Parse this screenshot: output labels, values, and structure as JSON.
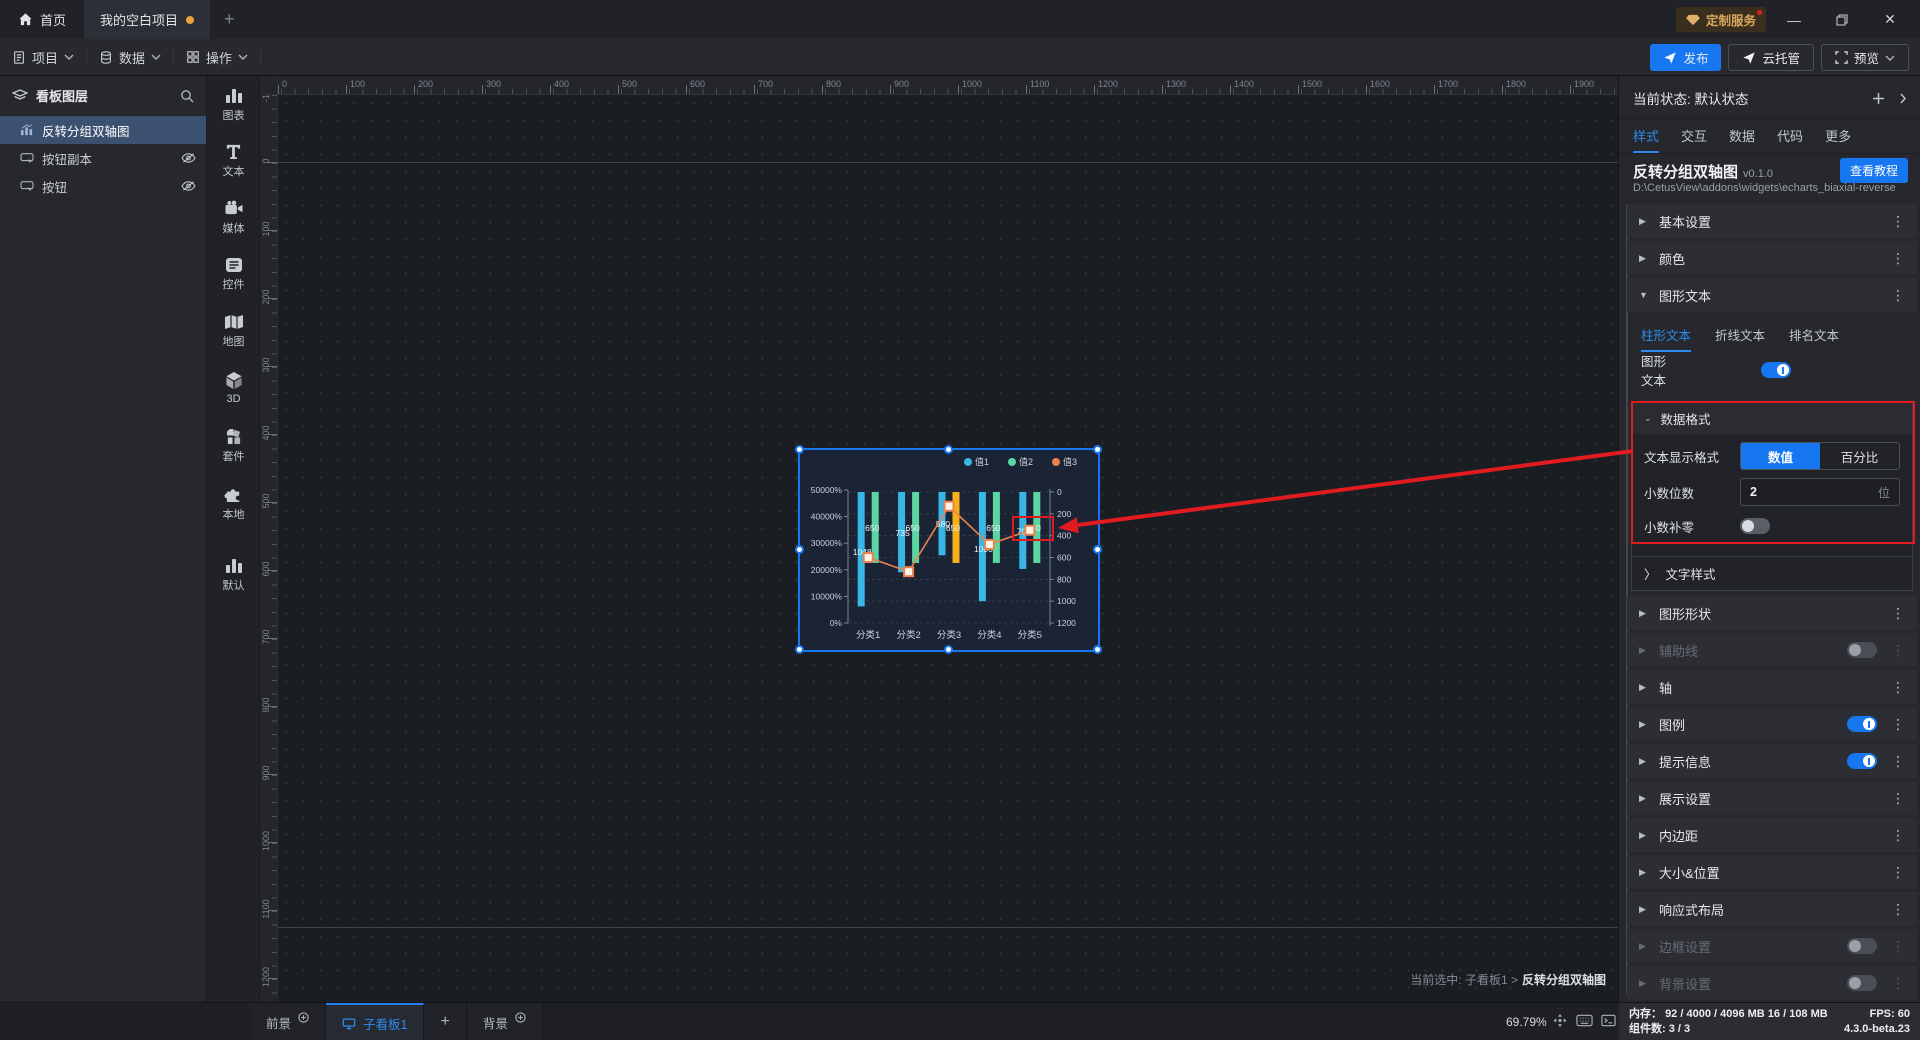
{
  "window": {
    "home_tab": "首页",
    "project_tab": "我的空白项目",
    "service_badge": "定制服务"
  },
  "menubar": {
    "items": [
      {
        "label": "项目",
        "icon": "doc"
      },
      {
        "label": "数据",
        "icon": "db"
      },
      {
        "label": "操作",
        "icon": "grid"
      }
    ],
    "publish": "发布",
    "cloud": "云托管",
    "preview": "预览"
  },
  "layers": {
    "title": "看板图层",
    "items": [
      {
        "label": "反转分组双轴图",
        "icon": "chart",
        "selected": true,
        "eye": false
      },
      {
        "label": "按钮副本",
        "icon": "button",
        "selected": false,
        "eye": true
      },
      {
        "label": "按钮",
        "icon": "button",
        "selected": false,
        "eye": true
      }
    ]
  },
  "dock": {
    "items": [
      {
        "label": "图表",
        "icon": "bars"
      },
      {
        "label": "文本",
        "icon": "text"
      },
      {
        "label": "媒体",
        "icon": "media"
      },
      {
        "label": "控件",
        "icon": "widgetic"
      },
      {
        "label": "地图",
        "icon": "map"
      },
      {
        "label": "3D",
        "icon": "cube"
      },
      {
        "label": "套件",
        "icon": "kit"
      },
      {
        "label": "本地",
        "icon": "puzzle"
      },
      {
        "label": "默认",
        "icon": "bars"
      }
    ]
  },
  "canvas": {
    "h_ruler": [
      0,
      100,
      200,
      300,
      400,
      500,
      600,
      700,
      800,
      900,
      1000,
      1100,
      1200,
      1300,
      1400,
      1500,
      1600,
      1700,
      1800,
      1900
    ],
    "v_ruler": [
      -100,
      0,
      100,
      200,
      300,
      400,
      500,
      600,
      700,
      800,
      900,
      1000,
      1100,
      1200
    ],
    "status_prefix": "当前选中: 子看板1 >",
    "status_target": "反转分组双轴图"
  },
  "chart_data": {
    "type": "bar",
    "subtype": "grouped bars + line, reversed (bars hang from top), dual y-axis",
    "title": "",
    "categories": [
      "分类1",
      "分类2",
      "分类3",
      "分类4",
      "分类5"
    ],
    "series": [
      {
        "name": "值1",
        "type": "bar",
        "color": "#38b6e6",
        "values": [
          1048,
          735,
          580,
          1000,
          705
        ]
      },
      {
        "name": "值2",
        "type": "bar",
        "color": "#5bd6a2",
        "values": [
          650,
          650,
          650,
          650,
          650
        ],
        "highlight_index": 2,
        "highlight_color": "#f5b01a"
      },
      {
        "name": "值3",
        "type": "line",
        "color": "#e8834f",
        "values": [
          600,
          730,
          130,
          480,
          350
        ]
      }
    ],
    "left_axis_labels": [
      "50000%",
      "40000%",
      "30000%",
      "20000%",
      "10000%",
      "0%"
    ],
    "right_axis": {
      "min": 0,
      "max": 1200,
      "step": 200,
      "direction": "down"
    },
    "legend": [
      "值1",
      "值2",
      "值3"
    ],
    "grid": "dashed horizontal",
    "legend_position": "top-right"
  },
  "inspector": {
    "state_label": "当前状态:",
    "state_value": "默认状态",
    "tabs": [
      "样式",
      "交互",
      "数据",
      "代码",
      "更多"
    ],
    "active_tab": "样式",
    "widget_title": "反转分组双轴图",
    "widget_version": "v0.1.0",
    "tutorial_btn": "查看教程",
    "widget_path": "D:\\CetusView\\addons\\widgets\\echarts_biaxial-reverse",
    "sections_top": [
      {
        "label": "基本设置",
        "state": "collapsed"
      },
      {
        "label": "颜色",
        "state": "collapsed"
      },
      {
        "label": "图形文本",
        "state": "expanded"
      }
    ],
    "graphic_text": {
      "sub_tabs": [
        "柱形文本",
        "折线文本",
        "排名文本"
      ],
      "active_sub_tab": "柱形文本",
      "toggle_label": "图形文本",
      "toggle_on": true,
      "data_format": {
        "title": "数据格式",
        "display_format_label": "文本显示格式",
        "format_options": [
          "数值",
          "百分比"
        ],
        "active_format": "数值",
        "decimal_label": "小数位数",
        "decimal_value": "2",
        "decimal_unit": "位",
        "pad_zero_label": "小数补零",
        "pad_zero_on": false
      },
      "text_style_label": "文字样式"
    },
    "sections_bottom": [
      {
        "label": "图形形状"
      },
      {
        "label": "辅助线",
        "disabled": true,
        "toggle": "off"
      },
      {
        "label": "轴"
      },
      {
        "label": "图例",
        "toggle": "on"
      },
      {
        "label": "提示信息",
        "toggle": "on"
      },
      {
        "label": "展示设置"
      },
      {
        "label": "内边距"
      },
      {
        "label": "大小&位置"
      },
      {
        "label": "响应式布局"
      },
      {
        "label": "边框设置",
        "disabled": true,
        "toggle": "off"
      },
      {
        "label": "背景设置",
        "disabled": true,
        "toggle": "off"
      }
    ]
  },
  "statusbar": {
    "foreground_tab": "前景",
    "board_tab": "子看板1",
    "background_tab": "背景",
    "zoom": "69.79%",
    "memory_label": "内存：",
    "memory_value": "92 / 4000 / 4096 MB  16 / 108 MB",
    "fps_label": "FPS:",
    "fps_value": "60",
    "components_label": "组件数:",
    "components_value": "3 / 3",
    "version": "4.3.0-beta.23"
  }
}
